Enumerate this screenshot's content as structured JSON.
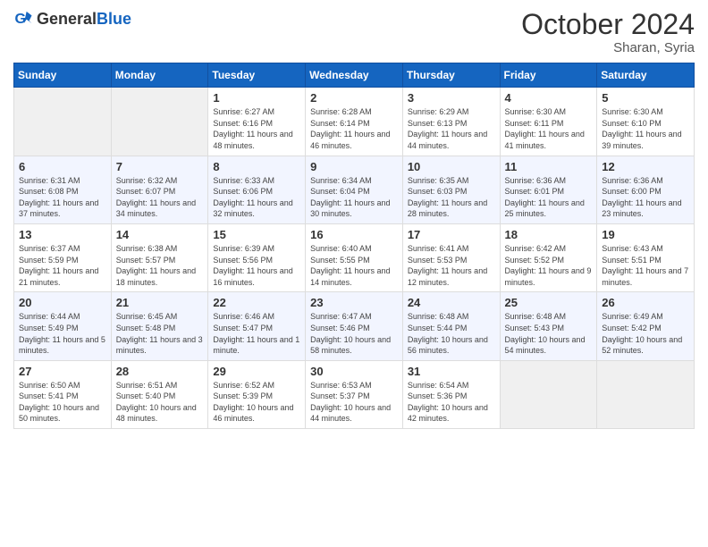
{
  "logo": {
    "general": "General",
    "blue": "Blue"
  },
  "title": "October 2024",
  "location": "Sharan, Syria",
  "days_header": [
    "Sunday",
    "Monday",
    "Tuesday",
    "Wednesday",
    "Thursday",
    "Friday",
    "Saturday"
  ],
  "weeks": [
    [
      {
        "num": "",
        "detail": ""
      },
      {
        "num": "",
        "detail": ""
      },
      {
        "num": "1",
        "detail": "Sunrise: 6:27 AM\nSunset: 6:16 PM\nDaylight: 11 hours and 48 minutes."
      },
      {
        "num": "2",
        "detail": "Sunrise: 6:28 AM\nSunset: 6:14 PM\nDaylight: 11 hours and 46 minutes."
      },
      {
        "num": "3",
        "detail": "Sunrise: 6:29 AM\nSunset: 6:13 PM\nDaylight: 11 hours and 44 minutes."
      },
      {
        "num": "4",
        "detail": "Sunrise: 6:30 AM\nSunset: 6:11 PM\nDaylight: 11 hours and 41 minutes."
      },
      {
        "num": "5",
        "detail": "Sunrise: 6:30 AM\nSunset: 6:10 PM\nDaylight: 11 hours and 39 minutes."
      }
    ],
    [
      {
        "num": "6",
        "detail": "Sunrise: 6:31 AM\nSunset: 6:08 PM\nDaylight: 11 hours and 37 minutes."
      },
      {
        "num": "7",
        "detail": "Sunrise: 6:32 AM\nSunset: 6:07 PM\nDaylight: 11 hours and 34 minutes."
      },
      {
        "num": "8",
        "detail": "Sunrise: 6:33 AM\nSunset: 6:06 PM\nDaylight: 11 hours and 32 minutes."
      },
      {
        "num": "9",
        "detail": "Sunrise: 6:34 AM\nSunset: 6:04 PM\nDaylight: 11 hours and 30 minutes."
      },
      {
        "num": "10",
        "detail": "Sunrise: 6:35 AM\nSunset: 6:03 PM\nDaylight: 11 hours and 28 minutes."
      },
      {
        "num": "11",
        "detail": "Sunrise: 6:36 AM\nSunset: 6:01 PM\nDaylight: 11 hours and 25 minutes."
      },
      {
        "num": "12",
        "detail": "Sunrise: 6:36 AM\nSunset: 6:00 PM\nDaylight: 11 hours and 23 minutes."
      }
    ],
    [
      {
        "num": "13",
        "detail": "Sunrise: 6:37 AM\nSunset: 5:59 PM\nDaylight: 11 hours and 21 minutes."
      },
      {
        "num": "14",
        "detail": "Sunrise: 6:38 AM\nSunset: 5:57 PM\nDaylight: 11 hours and 18 minutes."
      },
      {
        "num": "15",
        "detail": "Sunrise: 6:39 AM\nSunset: 5:56 PM\nDaylight: 11 hours and 16 minutes."
      },
      {
        "num": "16",
        "detail": "Sunrise: 6:40 AM\nSunset: 5:55 PM\nDaylight: 11 hours and 14 minutes."
      },
      {
        "num": "17",
        "detail": "Sunrise: 6:41 AM\nSunset: 5:53 PM\nDaylight: 11 hours and 12 minutes."
      },
      {
        "num": "18",
        "detail": "Sunrise: 6:42 AM\nSunset: 5:52 PM\nDaylight: 11 hours and 9 minutes."
      },
      {
        "num": "19",
        "detail": "Sunrise: 6:43 AM\nSunset: 5:51 PM\nDaylight: 11 hours and 7 minutes."
      }
    ],
    [
      {
        "num": "20",
        "detail": "Sunrise: 6:44 AM\nSunset: 5:49 PM\nDaylight: 11 hours and 5 minutes."
      },
      {
        "num": "21",
        "detail": "Sunrise: 6:45 AM\nSunset: 5:48 PM\nDaylight: 11 hours and 3 minutes."
      },
      {
        "num": "22",
        "detail": "Sunrise: 6:46 AM\nSunset: 5:47 PM\nDaylight: 11 hours and 1 minute."
      },
      {
        "num": "23",
        "detail": "Sunrise: 6:47 AM\nSunset: 5:46 PM\nDaylight: 10 hours and 58 minutes."
      },
      {
        "num": "24",
        "detail": "Sunrise: 6:48 AM\nSunset: 5:44 PM\nDaylight: 10 hours and 56 minutes."
      },
      {
        "num": "25",
        "detail": "Sunrise: 6:48 AM\nSunset: 5:43 PM\nDaylight: 10 hours and 54 minutes."
      },
      {
        "num": "26",
        "detail": "Sunrise: 6:49 AM\nSunset: 5:42 PM\nDaylight: 10 hours and 52 minutes."
      }
    ],
    [
      {
        "num": "27",
        "detail": "Sunrise: 6:50 AM\nSunset: 5:41 PM\nDaylight: 10 hours and 50 minutes."
      },
      {
        "num": "28",
        "detail": "Sunrise: 6:51 AM\nSunset: 5:40 PM\nDaylight: 10 hours and 48 minutes."
      },
      {
        "num": "29",
        "detail": "Sunrise: 6:52 AM\nSunset: 5:39 PM\nDaylight: 10 hours and 46 minutes."
      },
      {
        "num": "30",
        "detail": "Sunrise: 6:53 AM\nSunset: 5:37 PM\nDaylight: 10 hours and 44 minutes."
      },
      {
        "num": "31",
        "detail": "Sunrise: 6:54 AM\nSunset: 5:36 PM\nDaylight: 10 hours and 42 minutes."
      },
      {
        "num": "",
        "detail": ""
      },
      {
        "num": "",
        "detail": ""
      }
    ]
  ]
}
